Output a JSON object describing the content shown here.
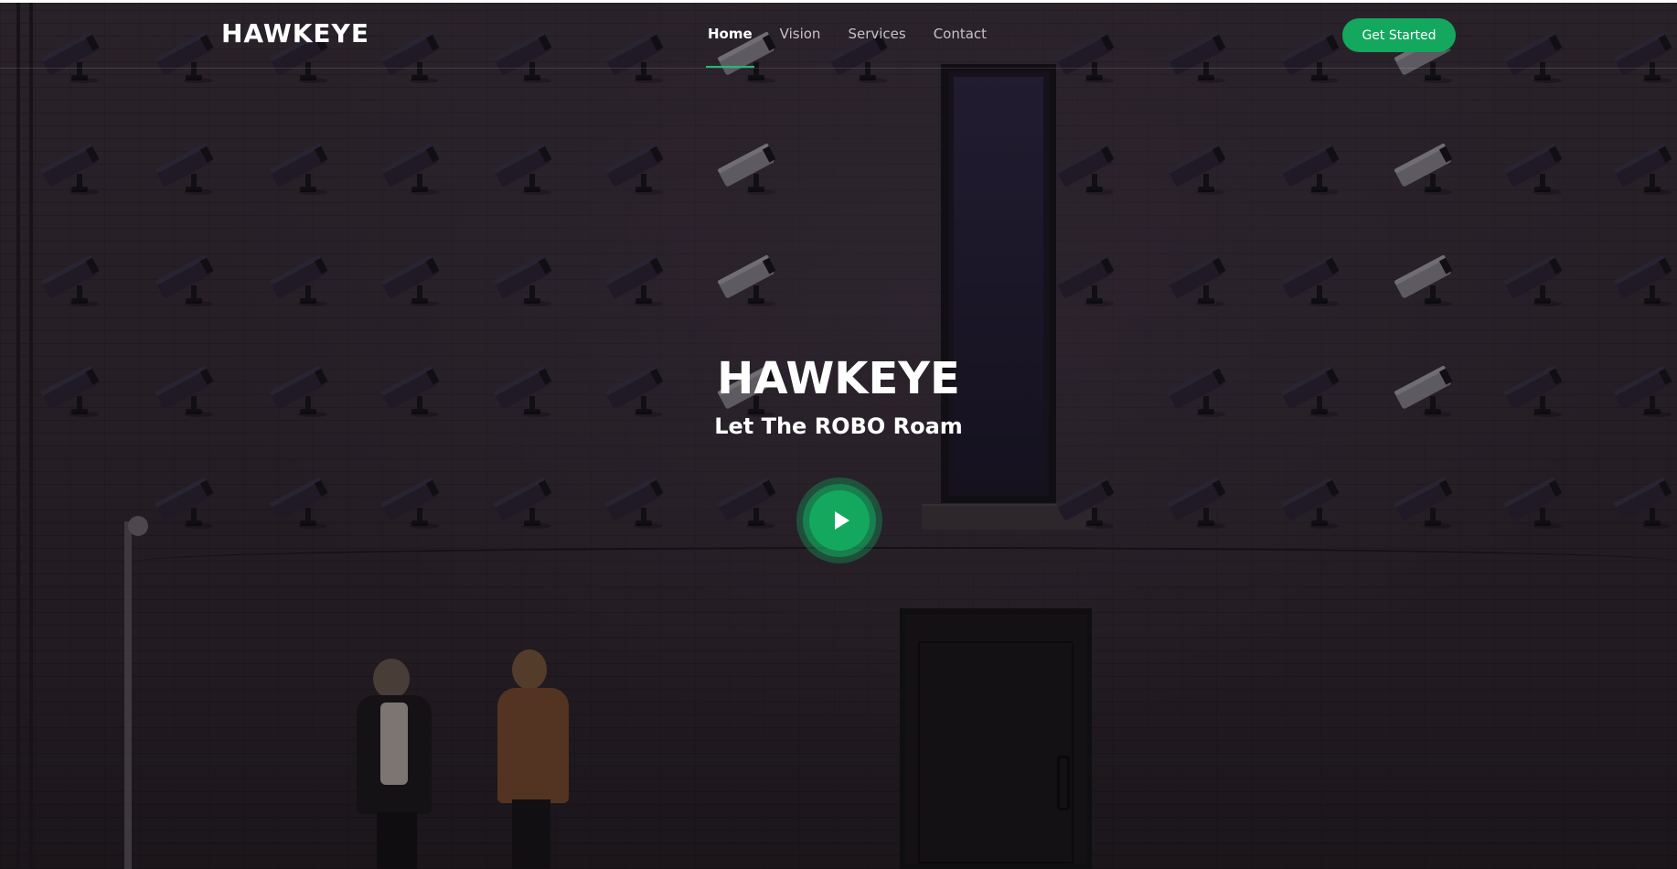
{
  "brand": {
    "logo_text": "HAWKEYE"
  },
  "nav": {
    "items": [
      {
        "label": "Home",
        "active": true
      },
      {
        "label": "Vision",
        "active": false
      },
      {
        "label": "Services",
        "active": false
      },
      {
        "label": "Contact",
        "active": false
      }
    ],
    "cta_label": "Get Started"
  },
  "hero": {
    "title": "HAWKEYE",
    "subtitle": "Let The ROBO Roam",
    "play_icon": "play-icon"
  },
  "colors": {
    "accent": "#13a85e",
    "accent_underline": "#1bbd73",
    "text": "#ffffff",
    "overlay": "#2a2329"
  }
}
